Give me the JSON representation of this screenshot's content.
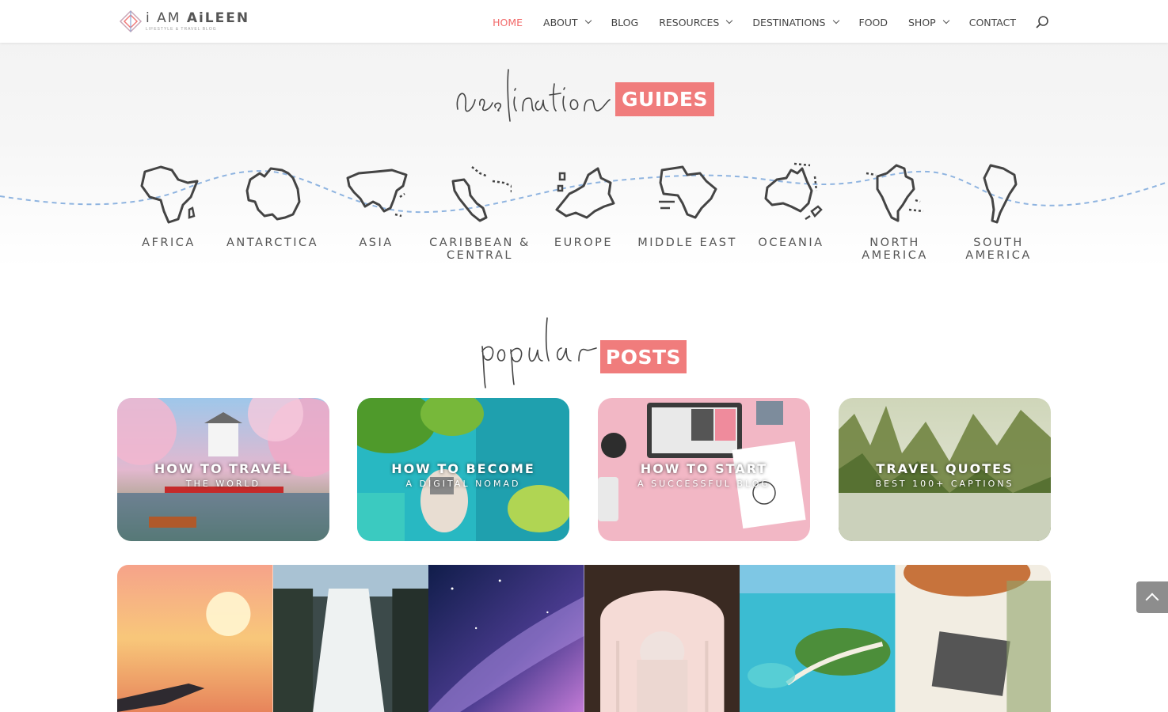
{
  "brand": {
    "name_light": "i AM ",
    "name_bold": "AiLEEN",
    "tagline": "LIFESTYLE & TRAVEL BLOG",
    "accent": "#f07c7c"
  },
  "nav": {
    "items": [
      {
        "label": "HOME",
        "active": true,
        "dropdown": false
      },
      {
        "label": "ABOUT",
        "active": false,
        "dropdown": true
      },
      {
        "label": "BLOG",
        "active": false,
        "dropdown": false
      },
      {
        "label": "RESOURCES",
        "active": false,
        "dropdown": true
      },
      {
        "label": "DESTINATIONS",
        "active": false,
        "dropdown": true
      },
      {
        "label": "FOOD",
        "active": false,
        "dropdown": false
      },
      {
        "label": "SHOP",
        "active": false,
        "dropdown": true
      },
      {
        "label": "CONTACT",
        "active": false,
        "dropdown": false
      }
    ],
    "search_icon": "search-icon"
  },
  "destinations": {
    "script_word": "destination",
    "badge": "GUIDES",
    "continents": [
      {
        "label_1": "AFRICA",
        "label_2": ""
      },
      {
        "label_1": "ANTARCTICA",
        "label_2": ""
      },
      {
        "label_1": "ASIA",
        "label_2": ""
      },
      {
        "label_1": "CARIBBEAN &",
        "label_2": "CENTRAL"
      },
      {
        "label_1": "EUROPE",
        "label_2": ""
      },
      {
        "label_1": "MIDDLE EAST",
        "label_2": ""
      },
      {
        "label_1": "OCEANIA",
        "label_2": ""
      },
      {
        "label_1": "NORTH",
        "label_2": "AMERICA"
      },
      {
        "label_1": "SOUTH",
        "label_2": "AMERICA"
      }
    ]
  },
  "popular": {
    "script_word": "popular",
    "badge": "POSTS",
    "posts": [
      {
        "title": "HOW TO TRAVEL",
        "subtitle": "THE WORLD"
      },
      {
        "title": "HOW TO BECOME",
        "subtitle": "A DIGITAL NOMAD"
      },
      {
        "title": "HOW TO START",
        "subtitle": "A SUCCESSFUL BLOG"
      },
      {
        "title": "TRAVEL QUOTES",
        "subtitle": "BEST 100+ CAPTIONS"
      }
    ]
  },
  "back_to_top_icon": "chevron-up-icon"
}
